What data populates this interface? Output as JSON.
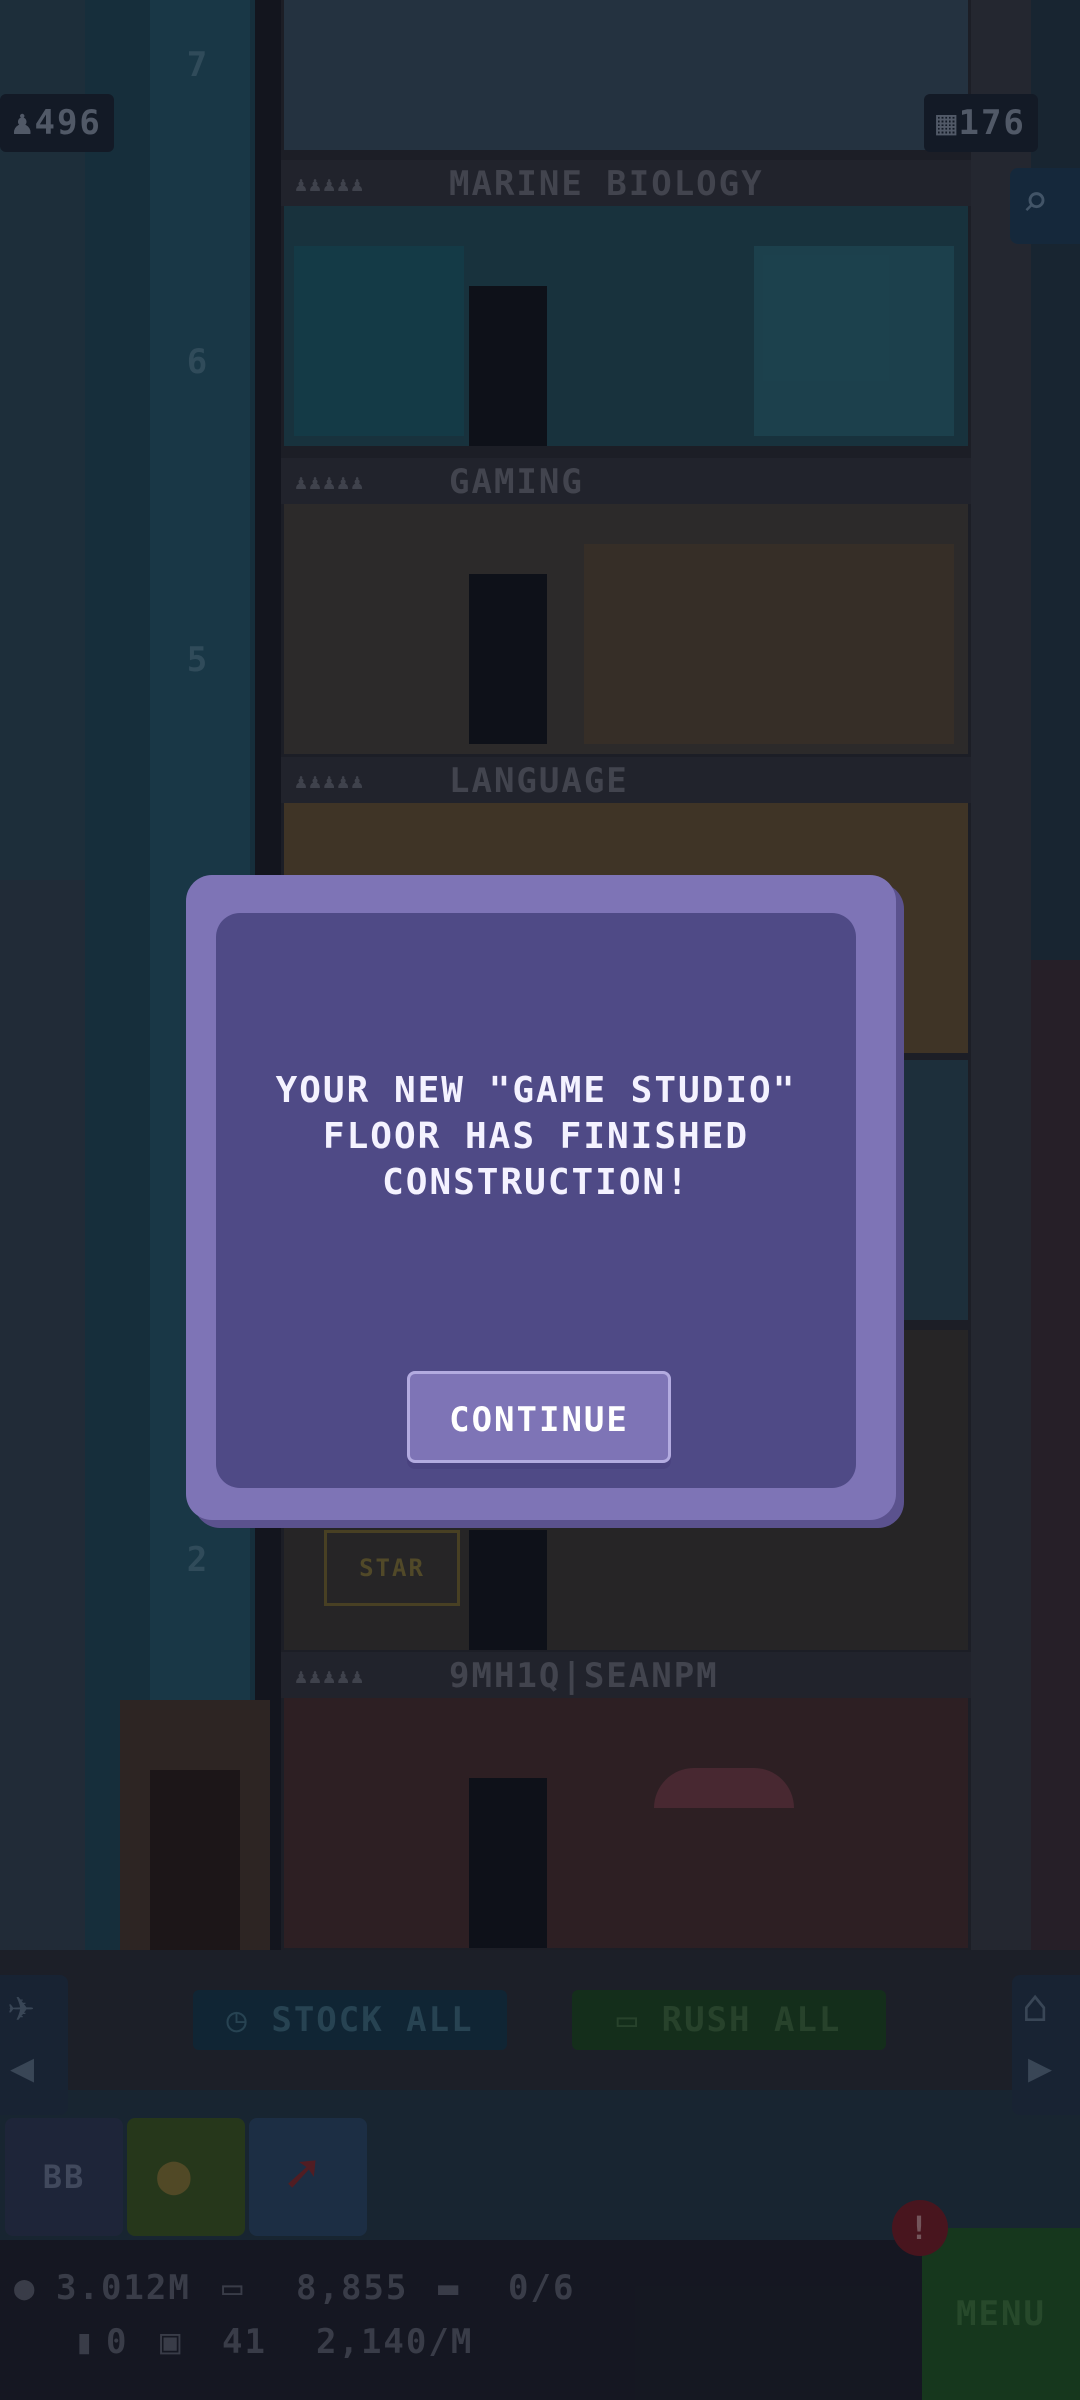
{
  "hud": {
    "population": "496",
    "population_icon": "person-icon",
    "floors": "176",
    "floors_icon": "building-icon",
    "search_icon": "magnifier-icon"
  },
  "floor_numbers": [
    "7",
    "6",
    "5",
    "2"
  ],
  "floors": [
    {
      "name": "MARINE BIOLOGY"
    },
    {
      "name": "GAMING"
    },
    {
      "name": "LANGUAGE"
    },
    {
      "name": "9MH1Q|SEANPM"
    }
  ],
  "room_signs": {
    "star": "STAR"
  },
  "dialog": {
    "message_lines": [
      "YOUR NEW \"GAME STUDIO\"",
      "FLOOR HAS FINISHED",
      "CONSTRUCTION!"
    ],
    "continue_label": "CONTINUE"
  },
  "actions": {
    "stock_all": "STOCK ALL",
    "rush_all": "RUSH ALL"
  },
  "tools": {
    "bb_label": "BB"
  },
  "status": {
    "coins": "3.012M",
    "bux": "8,855",
    "tickets": "0/6",
    "gems": "0",
    "vip": "41",
    "rate": "2,140/M",
    "menu_label": "MENU",
    "alert_label": "!"
  },
  "colors": {
    "dialog_bg": "#4f4a86",
    "dialog_border": "#7e74b6",
    "stock_bg": "#143a4a",
    "rush_bg": "#1c4a1c",
    "menu_bg": "#1f5a1f",
    "alert": "#c0262f"
  }
}
